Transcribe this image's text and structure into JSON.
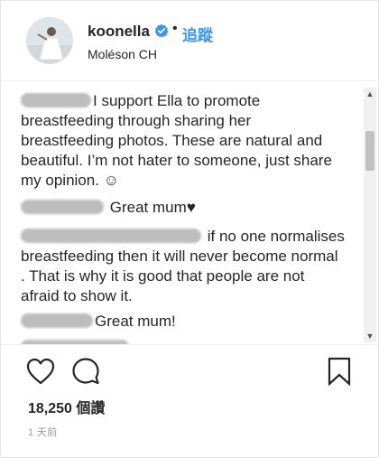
{
  "header": {
    "username": "koonella",
    "follow_separator": "•",
    "follow_label": "追蹤",
    "location": "Moléson CH",
    "verified_icon": "verified-badge-icon",
    "verified_color": "#3897f0"
  },
  "comments": [
    {
      "author_redacted": true,
      "text": "I support Ella to promote breastfeeding through sharing her breastfeeding photos. These are natural and beautiful. I’m not hater to someone, just share my opinion. ☺"
    },
    {
      "author_redacted": true,
      "text": "Great mum♥"
    },
    {
      "author_redacted": true,
      "text": "if no one normalises breastfeeding then it will never become normal . That is why it is good that people are not afraid to show it."
    },
    {
      "author_redacted": true,
      "text": "Great mum!"
    }
  ],
  "actions": {
    "like_icon": "heart-icon",
    "comment_icon": "comment-bubble-icon",
    "save_icon": "bookmark-icon"
  },
  "stats": {
    "views": "18,250 個讚",
    "time_ago": "1 天前"
  }
}
